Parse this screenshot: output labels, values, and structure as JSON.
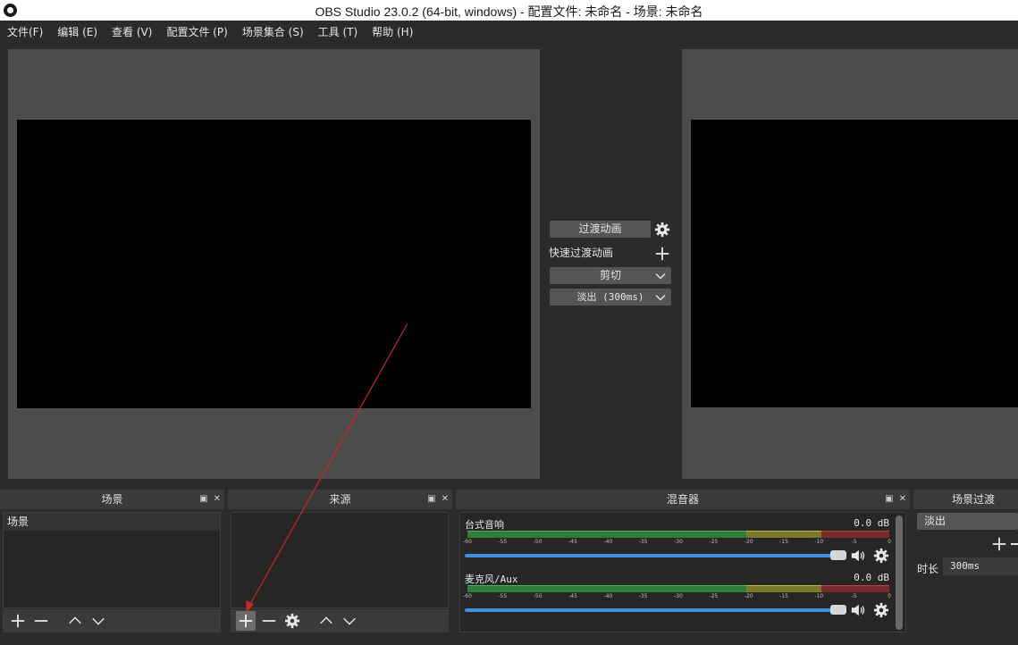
{
  "window": {
    "title": "OBS Studio 23.0.2 (64-bit, windows) - 配置文件: 未命名 - 场景: 未命名"
  },
  "menu": [
    "文件(F)",
    "编辑 (E)",
    "查看 (V)",
    "配置文件 (P)",
    "场景集合 (S)",
    "工具 (T)",
    "帮助 (H)"
  ],
  "transition": {
    "button_label": "过渡动画",
    "quick_label": "快速过渡动画",
    "cut_label": "剪切",
    "fade_label": "淡出 (300ms)"
  },
  "docks": {
    "scenes": {
      "title": "场景",
      "items": [
        "场景"
      ]
    },
    "sources": {
      "title": "来源"
    },
    "mixer": {
      "title": "混音器",
      "channels": [
        {
          "name": "台式音响",
          "db": "0.0 dB"
        },
        {
          "name": "麦克风/Aux",
          "db": "0.0 dB"
        }
      ],
      "ticks": [
        "-60",
        "-55",
        "-50",
        "-45",
        "-40",
        "-35",
        "-30",
        "-25",
        "-20",
        "-15",
        "-10",
        "-5",
        "0"
      ]
    },
    "scene_transitions": {
      "title": "场景过渡",
      "selected": "淡出",
      "duration_label": "时长",
      "duration_value": "300ms"
    }
  },
  "colors": {
    "accent_fader": "#3f8fde",
    "meter_green": "#2e7d3a",
    "meter_yellow": "#7a7a2a",
    "meter_red": "#7a2a2a",
    "annotation_arrow": "#c62828"
  }
}
